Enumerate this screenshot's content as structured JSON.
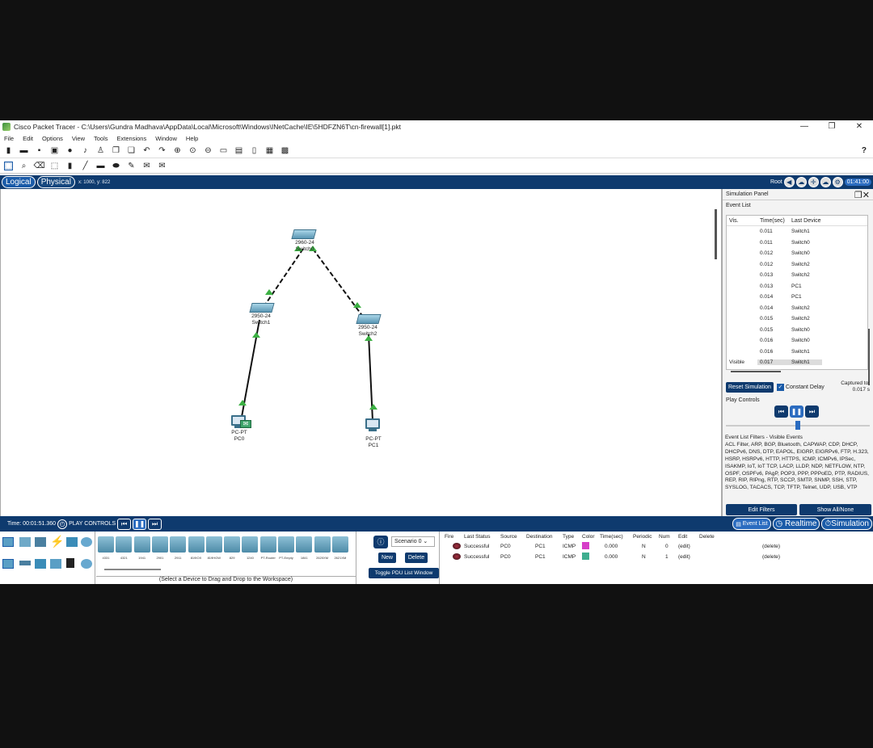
{
  "window": {
    "title": "Cisco Packet Tracer - C:\\Users\\Gundra Madhava\\AppData\\Local\\Microsoft\\Windows\\INetCache\\IE\\5HDFZN6T\\cn-firewall[1].pkt",
    "minimize": "—",
    "maximize": "❐",
    "close": "✕"
  },
  "menu": [
    "File",
    "Edit",
    "Options",
    "View",
    "Tools",
    "Extensions",
    "Window",
    "Help"
  ],
  "toolbar": {
    "help": "?"
  },
  "modebar": {
    "logical": "Logical",
    "physical": "Physical",
    "coords": "x: 1000, y: 822",
    "root": "Root",
    "clock": "01:41:00"
  },
  "topology": {
    "devices": [
      {
        "model": "2960-24",
        "name": "Switch0"
      },
      {
        "model": "2950-24",
        "name": "Switch1"
      },
      {
        "model": "2950-24",
        "name": "Switch2"
      },
      {
        "model": "PC-PT",
        "name": "PC0"
      },
      {
        "model": "PC-PT",
        "name": "PC1"
      }
    ]
  },
  "sim_panel": {
    "title": "Simulation Panel",
    "event_list_label": "Event List",
    "headers": [
      "Vis.",
      "Time(sec)",
      "Last Device"
    ],
    "events": [
      {
        "vis": "",
        "time": "0.011",
        "device": "Switch1"
      },
      {
        "vis": "",
        "time": "0.011",
        "device": "Switch0"
      },
      {
        "vis": "",
        "time": "0.012",
        "device": "Switch0"
      },
      {
        "vis": "",
        "time": "0.012",
        "device": "Switch2"
      },
      {
        "vis": "",
        "time": "0.013",
        "device": "Switch2"
      },
      {
        "vis": "",
        "time": "0.013",
        "device": "PC1"
      },
      {
        "vis": "",
        "time": "0.014",
        "device": "PC1"
      },
      {
        "vis": "",
        "time": "0.014",
        "device": "Switch2"
      },
      {
        "vis": "",
        "time": "0.015",
        "device": "Switch2"
      },
      {
        "vis": "",
        "time": "0.015",
        "device": "Switch0"
      },
      {
        "vis": "",
        "time": "0.016",
        "device": "Switch0"
      },
      {
        "vis": "",
        "time": "0.016",
        "device": "Switch1"
      },
      {
        "vis": "Visible",
        "time": "0.017",
        "device": "Switch1"
      }
    ],
    "reset_button": "Reset Simulation",
    "constant_delay": "Constant Delay",
    "captured_label": "Captured to:",
    "captured_value": "0.017 s",
    "play_controls": "Play Controls",
    "filters_label": "Event List Filters - Visible Events",
    "filters_text": "ACL Filter, ARP, BGP, Bluetooth, CAPWAP, CDP, DHCP, DHCPv6, DNS, DTP, EAPOL, EIGRP, EIGRPv6, FTP, H.323, HSRP, HSRPv6, HTTP, HTTPS, ICMP, ICMPv6, IPSec, ISAKMP, IoT, IoT TCP, LACP, LLDP, NDP, NETFLOW, NTP, OSPF, OSPFv6, PAgP, POP3, PPP, PPPoED, PTP, RADIUS, REP, RIP, RIPng, RTP, SCCP, SMTP, SNMP, SSH, STP, SYSLOG, TACACS, TCP, TFTP, Telnet, UDP, USB, VTP",
    "edit_filters": "Edit Filters",
    "show_all": "Show All/None"
  },
  "timebar": {
    "time": "Time: 00:01:51.360",
    "play_controls": "PLAY CONTROLS",
    "tabs": {
      "event_list": "Event List",
      "realtime": "Realtime",
      "simulation": "Simulation"
    }
  },
  "device_panel": {
    "models": [
      "4331",
      "4321",
      "1941",
      "2901",
      "2911",
      "819IOX",
      "819HGW",
      "829",
      "1240",
      "PT-Router",
      "PT-Empty",
      "1841",
      "2620XM",
      "2621XM"
    ],
    "hint": "(Select a Device to Drag and Drop to the Workspace)"
  },
  "scenario": {
    "label": "Scenario 0",
    "new": "New",
    "delete": "Delete",
    "toggle": "Toggle PDU List Window"
  },
  "pdu_list": {
    "headers": [
      "Fire",
      "Last Status",
      "Source",
      "Destination",
      "Type",
      "Color",
      "Time(sec)",
      "Periodic",
      "Num",
      "Edit",
      "Delete"
    ],
    "rows": [
      {
        "status": "Successful",
        "source": "PC0",
        "dest": "PC1",
        "type": "ICMP",
        "color": "#d63fc8",
        "time": "0.000",
        "periodic": "N",
        "num": "0",
        "edit": "(edit)",
        "delete": "(delete)"
      },
      {
        "status": "Successful",
        "source": "PC0",
        "dest": "PC1",
        "type": "ICMP",
        "color": "#3fae8f",
        "time": "0.000",
        "periodic": "N",
        "num": "1",
        "edit": "(edit)",
        "delete": "(delete)"
      }
    ]
  }
}
